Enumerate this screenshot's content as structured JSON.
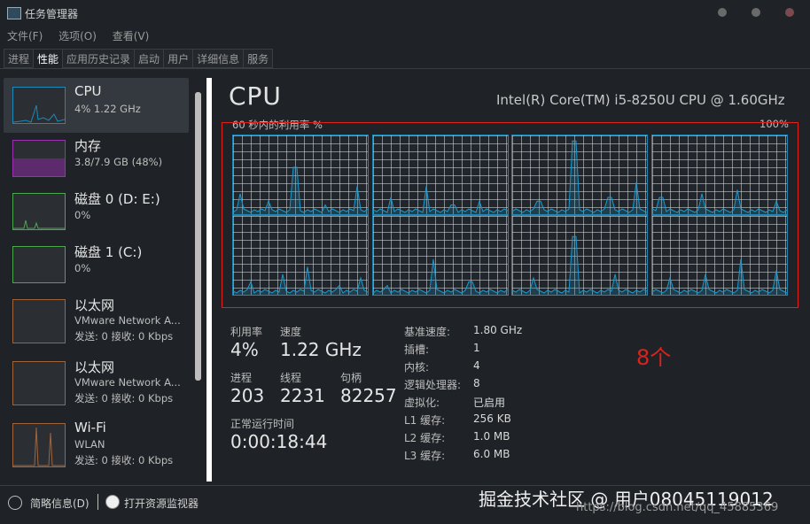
{
  "window": {
    "title": "任务管理器"
  },
  "menu": [
    "文件(F)",
    "选项(O)",
    "查看(V)"
  ],
  "tabs": [
    "进程",
    "性能",
    "应用历史记录",
    "启动",
    "用户",
    "详细信息",
    "服务"
  ],
  "sidebar": {
    "items": [
      {
        "title": "CPU",
        "line1": "4% 1.22 GHz",
        "line2": "",
        "color": "#1b89b8"
      },
      {
        "title": "内存",
        "line1": "3.8/7.9 GB (48%)",
        "line2": "",
        "color": "#9b30b0"
      },
      {
        "title": "磁盘 0 (D: E:)",
        "line1": "0%",
        "line2": "",
        "color": "#4ca64c"
      },
      {
        "title": "磁盘 1 (C:)",
        "line1": "0%",
        "line2": "",
        "color": "#4ca64c"
      },
      {
        "title": "以太网",
        "line1": "VMware Network A...",
        "line2": "发送: 0 接收: 0 Kbps",
        "color": "#a0643a"
      },
      {
        "title": "以太网",
        "line1": "VMware Network A...",
        "line2": "发送: 0 接收: 0 Kbps",
        "color": "#a0643a"
      },
      {
        "title": "Wi-Fi",
        "line1": "WLAN",
        "line2": "发送: 0 接收: 0 Kbps",
        "color": "#a0643a"
      }
    ]
  },
  "cpu": {
    "title": "CPU",
    "model": "Intel(R) Core(TM) i5-8250U CPU @ 1.60GHz",
    "graph_label": "60 秒内的利用率 %",
    "graph_max": "100%",
    "stats": {
      "utilization_label": "利用率",
      "utilization": "4%",
      "speed_label": "速度",
      "speed": "1.22 GHz",
      "processes_label": "进程",
      "processes": "203",
      "threads_label": "线程",
      "threads": "2231",
      "handles_label": "句柄",
      "handles": "82257",
      "uptime_label": "正常运行时间",
      "uptime": "0:00:18:44"
    },
    "details": [
      {
        "k": "基准速度:",
        "v": "1.80 GHz"
      },
      {
        "k": "插槽:",
        "v": "1"
      },
      {
        "k": "内核:",
        "v": "4"
      },
      {
        "k": "逻辑处理器:",
        "v": "8"
      },
      {
        "k": "虚拟化:",
        "v": "已启用"
      },
      {
        "k": "L1 缓存:",
        "v": "256 KB"
      },
      {
        "k": "L2 缓存:",
        "v": "1.0 MB"
      },
      {
        "k": "L3 缓存:",
        "v": "6.0 MB"
      }
    ]
  },
  "annotation": "8个",
  "footer": {
    "fewer_details": "简略信息(D)",
    "open_monitor": "打开资源监视器"
  },
  "watermark": {
    "line1": "掘金技术社区 @ 用户08045119012",
    "line2": "https://blog.csdn.net/qq_45885369"
  }
}
